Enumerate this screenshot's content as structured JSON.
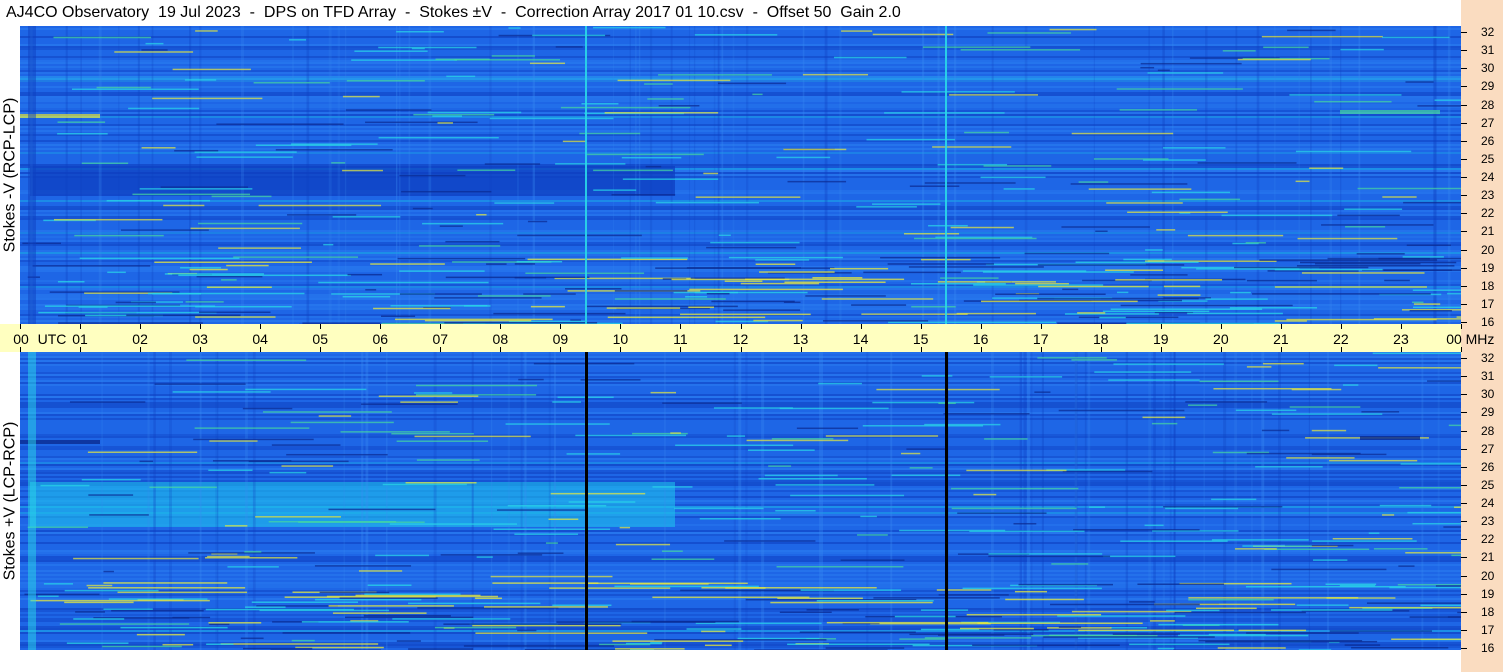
{
  "title": "AJ4CO Observatory  19 Jul 2023  -  DPS on TFD Array  -  Stokes ±V  -  Correction Array 2017 01 10.csv  -  Offset 50  Gain 2.0",
  "panels": [
    {
      "name": "stokes-minus-v",
      "ylabel": "Stokes -V (RCP-LCP)"
    },
    {
      "name": "stokes-plus-v",
      "ylabel": "Stokes +V (LCP-RCP)"
    }
  ],
  "time_axis": {
    "labels": [
      "00",
      "01",
      "02",
      "03",
      "04",
      "05",
      "06",
      "07",
      "08",
      "09",
      "10",
      "11",
      "12",
      "13",
      "14",
      "15",
      "16",
      "17",
      "18",
      "19",
      "20",
      "21",
      "22",
      "23",
      "00"
    ],
    "utc_label": "UTC",
    "unit_label": "MHz"
  },
  "freq_axis": {
    "labels": [
      "32",
      "31",
      "30",
      "29",
      "28",
      "27",
      "26",
      "25",
      "24",
      "23",
      "22",
      "21",
      "20",
      "19",
      "18",
      "17",
      "16"
    ]
  },
  "colors": {
    "background_blue": "#1e66e6",
    "dark_blue": "#0e3fc0",
    "cyan": "#2ad8e8",
    "yellow": "#e8ea3c",
    "axis_bg": "#ffffc0",
    "strip_bg": "#fadcc0"
  }
}
